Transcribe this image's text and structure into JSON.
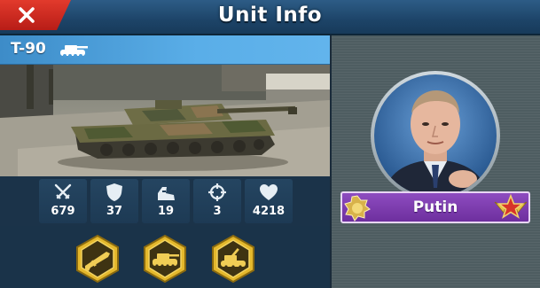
{
  "header": {
    "title": "Unit Info",
    "close_icon": "close-icon"
  },
  "unit": {
    "name": "T-90",
    "type_icon": "tank-icon"
  },
  "stats": [
    {
      "icon": "crossed-swords-icon",
      "value": "679"
    },
    {
      "icon": "shield-icon",
      "value": "37"
    },
    {
      "icon": "boot-icon",
      "value": "19"
    },
    {
      "icon": "crosshair-icon",
      "value": "3"
    },
    {
      "icon": "heart-icon",
      "value": "4218"
    }
  ],
  "skills": [
    {
      "icon": "rifle-skill-icon"
    },
    {
      "icon": "tank-skill-icon"
    },
    {
      "icon": "artillery-skill-icon"
    }
  ],
  "commander": {
    "name": "Putin",
    "left_badge": "medal-badge-icon",
    "right_badge": "star-wings-rank-icon"
  },
  "colors": {
    "header": "#1d4468",
    "close_button": "#d02a20",
    "unit_bar": "#5aaee8",
    "name_plate": "#7e3db0",
    "skill_gold": "#e2b52a"
  }
}
